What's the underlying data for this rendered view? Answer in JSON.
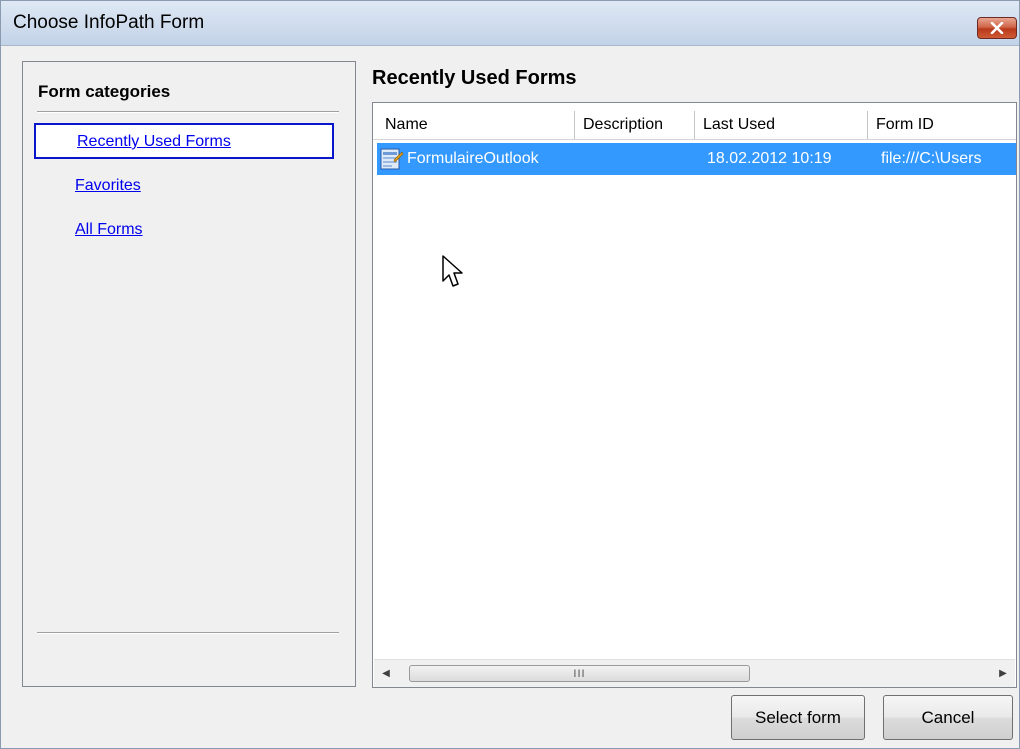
{
  "window": {
    "title": "Choose InfoPath Form"
  },
  "left_panel": {
    "heading": "Form categories",
    "categories": [
      {
        "label": "Recently Used Forms",
        "selected": true
      },
      {
        "label": "Favorites",
        "selected": false
      },
      {
        "label": "All Forms",
        "selected": false
      }
    ]
  },
  "main": {
    "heading": "Recently Used Forms",
    "columns": [
      "Name",
      "Description",
      "Last Used",
      "Form ID"
    ],
    "rows": [
      {
        "name": "FormulaireOutlook",
        "description": "",
        "last_used": "18.02.2012 10:19",
        "form_id": "file:///C:\\Users",
        "selected": true,
        "icon": "infopath-form-icon"
      }
    ],
    "scrollbar_thumb_grip": "III"
  },
  "buttons": {
    "select_form": "Select form",
    "cancel": "Cancel"
  },
  "colors": {
    "selection": "#3399ff",
    "link": "#0000ee",
    "title_bar": "#cfdced",
    "close_button": "#c7462a"
  }
}
